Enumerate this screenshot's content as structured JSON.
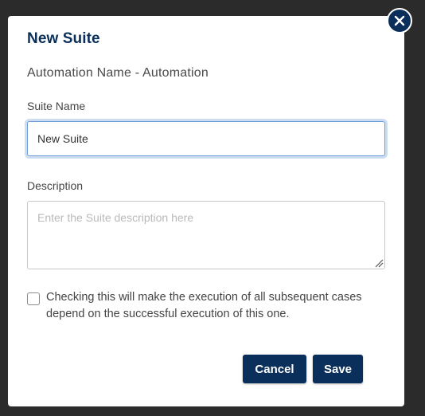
{
  "modal": {
    "title": "New Suite",
    "subtitle": "Automation Name - Automation",
    "suite_name_label": "Suite Name",
    "suite_name_value": "New Suite",
    "description_label": "Description",
    "description_placeholder": "Enter the Suite description here",
    "description_value": "",
    "dependency_checkbox_checked": false,
    "dependency_text": "Checking this will make the execution of all subsequent cases depend on the successful execution of this one.",
    "cancel_label": "Cancel",
    "save_label": "Save",
    "close_icon": "close-icon"
  },
  "colors": {
    "primary": "#0b2f5b",
    "backdrop": "#2b2b2b",
    "focus_border": "#6f9fd8"
  }
}
